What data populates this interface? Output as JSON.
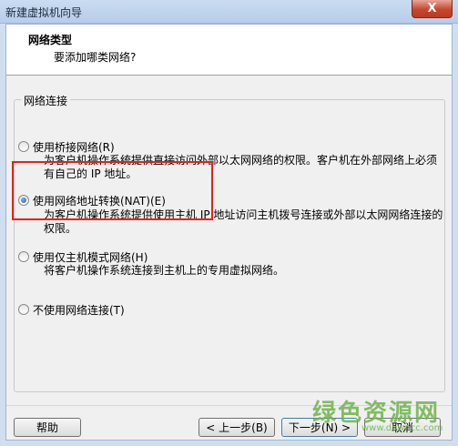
{
  "window": {
    "title": "新建虚拟机向导",
    "close_symbol": "X"
  },
  "header": {
    "title": "网络类型",
    "subtitle": "要添加哪类网络?"
  },
  "group": {
    "legend": "网络连接"
  },
  "options": [
    {
      "label": "使用桥接网络(R)",
      "description_line1": "为客户机操作系统提供直接访问外部以太网网络的权限。客户机在外部网络上必须",
      "description_line2": "有自己的 IP 地址。",
      "selected": false
    },
    {
      "label": "使用网络地址转换(NAT)(E)",
      "description_line1": "为客户机操作系统提供使用主机 IP 地址访问主机拨号连接或外部以太网网络连接的",
      "description_line2": "权限。",
      "selected": true
    },
    {
      "label": "使用仅主机模式网络(H)",
      "description_line1": "将客户机操作系统连接到主机上的专用虚拟网络。",
      "selected": false
    },
    {
      "label": "不使用网络连接(T)",
      "selected": false
    }
  ],
  "buttons": {
    "help": "帮助",
    "back": "< 上一步(B)",
    "next": "下一步(N) >",
    "cancel": "取消"
  },
  "watermark": {
    "text": "绿色资源网",
    "sub": "www.downcc.com"
  },
  "colors": {
    "highlight": "#e0241b",
    "watermark": "#6fb44d"
  }
}
